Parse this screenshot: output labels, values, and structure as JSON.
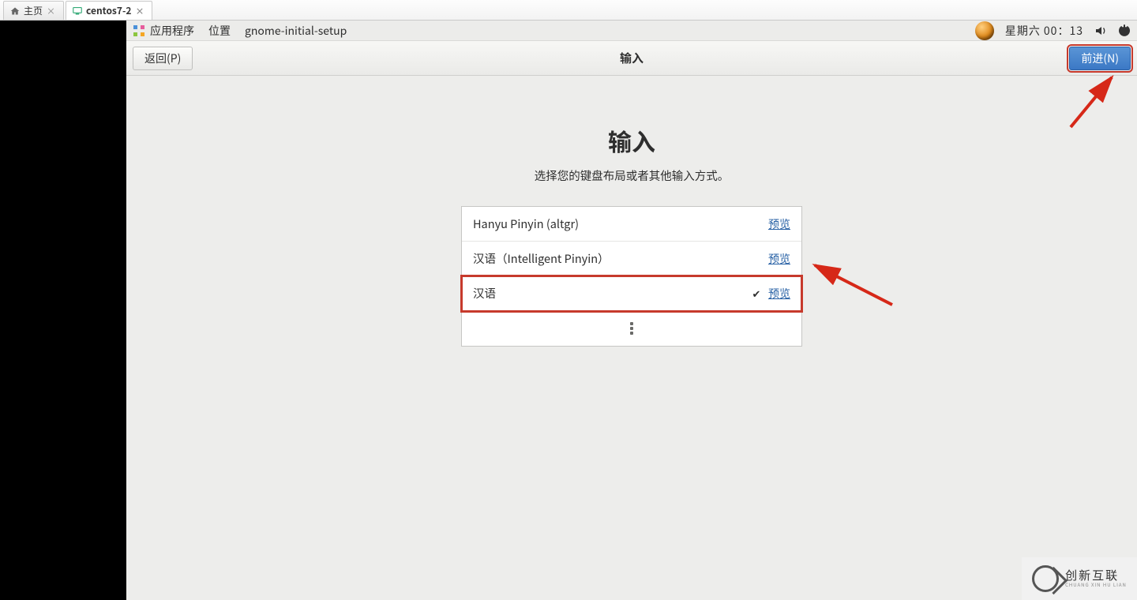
{
  "vm_tabs": {
    "home_label": "主页",
    "centos_label": "centos7-2"
  },
  "panel": {
    "applications": "应用程序",
    "places": "位置",
    "current_app": "gnome-initial-setup",
    "clock_day": "星期六",
    "clock_time": "00：13"
  },
  "headerbar": {
    "back": "返回(P)",
    "title": "输入",
    "next": "前进(N)"
  },
  "page": {
    "big_title": "输入",
    "subtitle": "选择您的键盘布局或者其他输入方式。"
  },
  "keyboards": [
    {
      "label": "Hanyu Pinyin (altgr)",
      "preview": "预览",
      "selected": false
    },
    {
      "label": "汉语（Intelligent Pinyin）",
      "preview": "预览",
      "selected": false
    },
    {
      "label": "汉语",
      "preview": "预览",
      "selected": true
    }
  ],
  "watermark": {
    "line1": "创新互联",
    "line2": "CHUANG XIN HU LIAN"
  }
}
